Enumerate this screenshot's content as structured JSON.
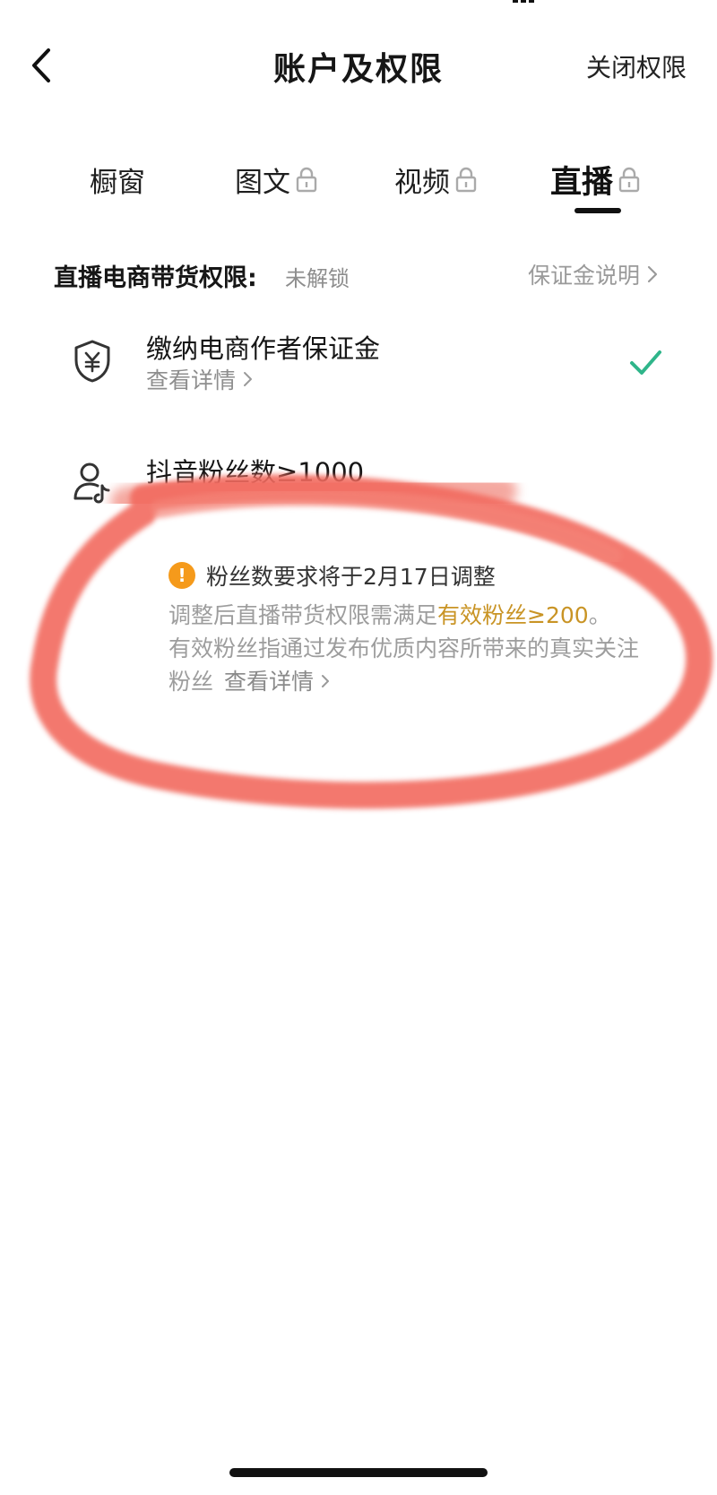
{
  "header": {
    "title": "账户及权限",
    "right_action": "关闭权限"
  },
  "tabs": [
    {
      "label": "橱窗",
      "locked": false,
      "active": false
    },
    {
      "label": "图文",
      "locked": true,
      "active": false
    },
    {
      "label": "视频",
      "locked": true,
      "active": false
    },
    {
      "label": "直播",
      "locked": true,
      "active": true
    }
  ],
  "section": {
    "title": "直播电商带货权限:",
    "status": "未解锁",
    "link": "保证金说明"
  },
  "requirements": [
    {
      "icon": "shield-yen-icon",
      "title": "缴纳电商作者保证金",
      "sub": "查看详情",
      "done": true
    },
    {
      "icon": "user-douyin-icon",
      "title": "抖音粉丝数≥1000",
      "done": false
    }
  ],
  "notice": {
    "title": "粉丝数要求将于2月17日调整",
    "line1_prefix": "调整后直播带货权限需满足",
    "line1_highlight": "有效粉丝≥200",
    "line1_suffix": "。",
    "line2": "有效粉丝指通过发布优质内容所带来的真实关注粉丝",
    "link": "查看详情"
  },
  "colors": {
    "accent_green": "#2fb58a",
    "warning_orange": "#f59a1b",
    "highlight_gold": "#c99425",
    "annotation_red": "#f26b5e"
  }
}
